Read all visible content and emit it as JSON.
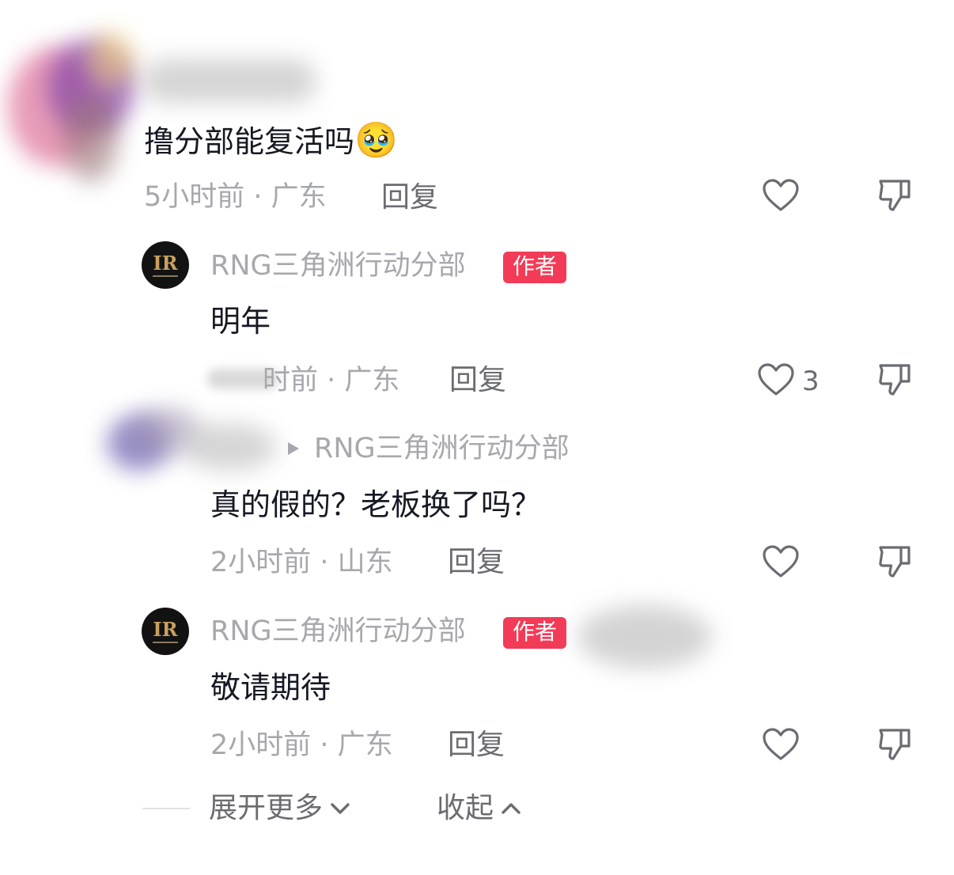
{
  "comment1": {
    "text": "撸分部能复活吗",
    "emoji": "🥹",
    "meta": "5小时前 · 广东",
    "reply_label": "回复"
  },
  "reply1": {
    "author": "RNG三角洲行动分部",
    "badge": "作者",
    "text": "明年",
    "meta": "时前 · 广东",
    "reply_label": "回复",
    "like_count": "3"
  },
  "reply2": {
    "reply_to": "RNG三角洲行动分部",
    "text": "真的假的？老板换了吗？",
    "meta": "2小时前 · 山东",
    "reply_label": "回复"
  },
  "reply3": {
    "author": "RNG三角洲行动分部",
    "badge": "作者",
    "text": "敬请期待",
    "meta": "2小时前 · 广东",
    "reply_label": "回复"
  },
  "footer": {
    "expand_label": "展开更多",
    "collapse_label": "收起"
  },
  "icons": {
    "like": "heart-outline-icon",
    "dislike": "thumbs-down-outline-icon",
    "expand": "chevron-down-icon",
    "collapse": "chevron-up-icon",
    "reply_arrow": "triangle-right-icon"
  },
  "colors": {
    "badge": "#f23b57",
    "text": "#161823",
    "meta": "#a7a8ad",
    "action": "#6b6c72"
  }
}
